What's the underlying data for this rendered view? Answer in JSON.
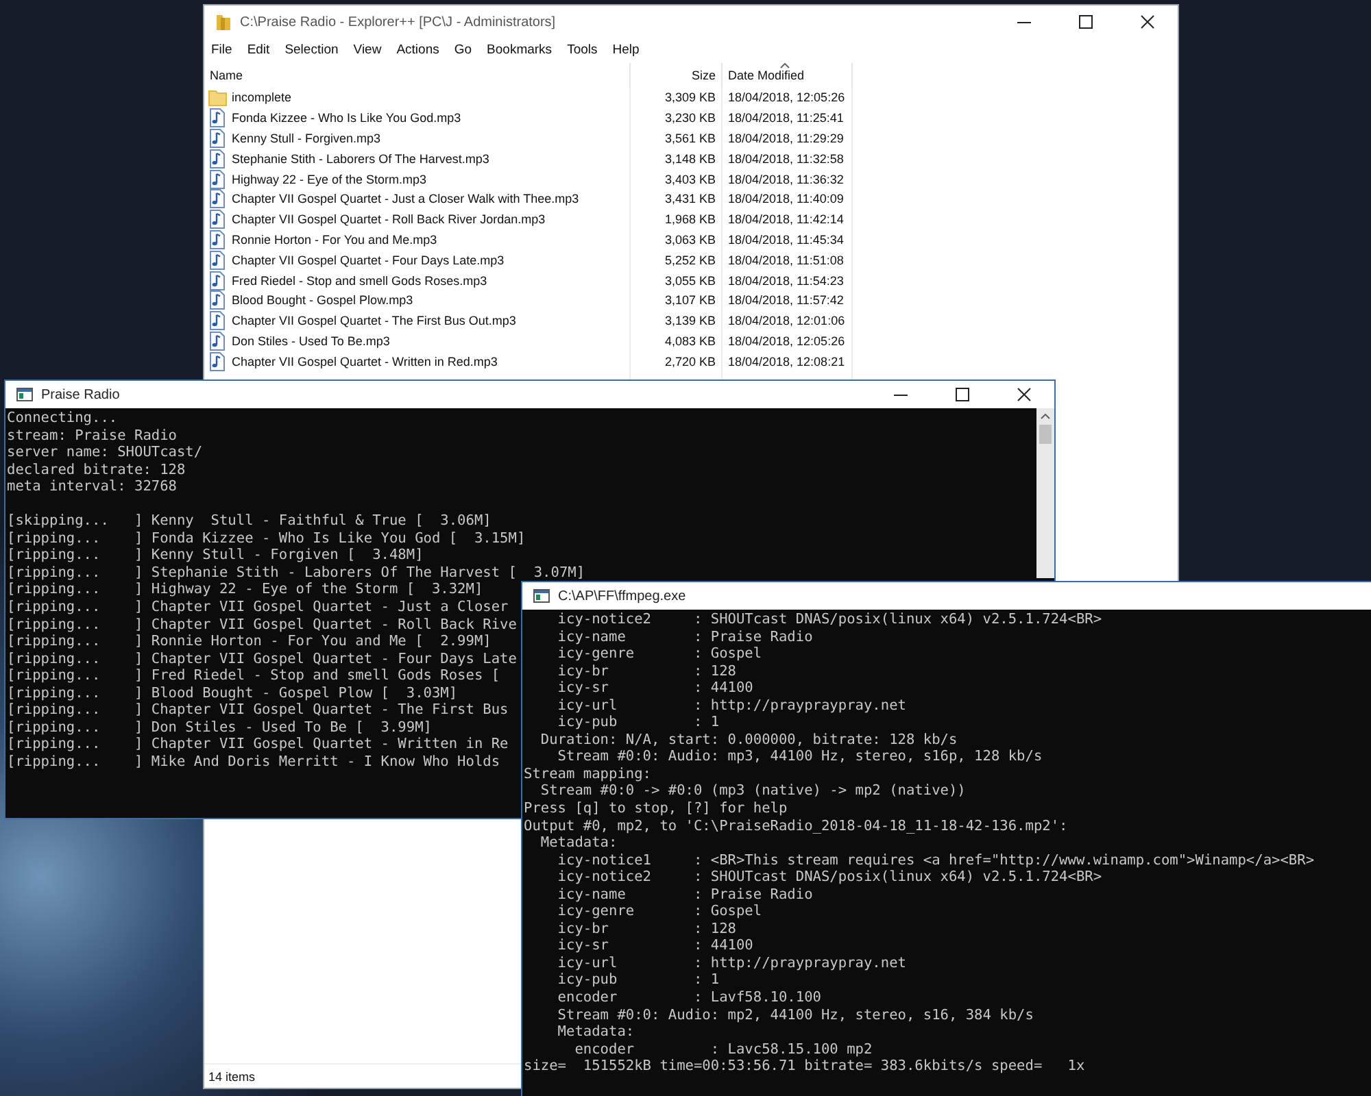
{
  "explorer": {
    "title": "C:\\Praise Radio - Explorer++ [PC\\J - Administrators]",
    "menu": [
      "File",
      "Edit",
      "Selection",
      "View",
      "Actions",
      "Go",
      "Bookmarks",
      "Tools",
      "Help"
    ],
    "columns": [
      {
        "label": "Name",
        "sorted": false
      },
      {
        "label": "Size",
        "sorted": false
      },
      {
        "label": "Date Modified",
        "sorted": true
      }
    ],
    "rows": [
      {
        "kind": "folder",
        "name": "incomplete",
        "size": "3,309 KB",
        "modified": "18/04/2018, 12:05:26"
      },
      {
        "kind": "audio",
        "name": "Fonda Kizzee - Who Is Like You God.mp3",
        "size": "3,230 KB",
        "modified": "18/04/2018, 11:25:41"
      },
      {
        "kind": "audio",
        "name": "Kenny Stull - Forgiven.mp3",
        "size": "3,561 KB",
        "modified": "18/04/2018, 11:29:29"
      },
      {
        "kind": "audio",
        "name": "Stephanie Stith - Laborers Of The Harvest.mp3",
        "size": "3,148 KB",
        "modified": "18/04/2018, 11:32:58"
      },
      {
        "kind": "audio",
        "name": "Highway 22 - Eye of the Storm.mp3",
        "size": "3,403 KB",
        "modified": "18/04/2018, 11:36:32"
      },
      {
        "kind": "audio",
        "name": "Chapter VII Gospel Quartet - Just a Closer Walk with Thee.mp3",
        "size": "3,431 KB",
        "modified": "18/04/2018, 11:40:09"
      },
      {
        "kind": "audio",
        "name": "Chapter VII Gospel Quartet - Roll Back River Jordan.mp3",
        "size": "1,968 KB",
        "modified": "18/04/2018, 11:42:14"
      },
      {
        "kind": "audio",
        "name": "Ronnie Horton - For You and Me.mp3",
        "size": "3,063 KB",
        "modified": "18/04/2018, 11:45:34"
      },
      {
        "kind": "audio",
        "name": "Chapter VII Gospel Quartet - Four Days Late.mp3",
        "size": "5,252 KB",
        "modified": "18/04/2018, 11:51:08"
      },
      {
        "kind": "audio",
        "name": "Fred Riedel - Stop and smell Gods Roses.mp3",
        "size": "3,055 KB",
        "modified": "18/04/2018, 11:54:23"
      },
      {
        "kind": "audio",
        "name": "Blood Bought - Gospel Plow.mp3",
        "size": "3,107 KB",
        "modified": "18/04/2018, 11:57:42"
      },
      {
        "kind": "audio",
        "name": "Chapter VII Gospel Quartet - The First Bus Out.mp3",
        "size": "3,139 KB",
        "modified": "18/04/2018, 12:01:06"
      },
      {
        "kind": "audio",
        "name": "Don Stiles - Used To Be.mp3",
        "size": "4,083 KB",
        "modified": "18/04/2018, 12:05:26"
      },
      {
        "kind": "audio",
        "name": "Chapter VII Gospel Quartet - Written in Red.mp3",
        "size": "2,720 KB",
        "modified": "18/04/2018, 12:08:21"
      }
    ],
    "status_bar": "14 items"
  },
  "streamripper": {
    "title": "Praise Radio",
    "header_lines": [
      "Connecting...",
      "stream: Praise Radio",
      "server name: SHOUTcast/",
      "declared bitrate: 128",
      "meta interval: 32768"
    ],
    "track_lines": [
      "[skipping...   ] Kenny  Stull - Faithful & True [  3.06M]",
      "[ripping...    ] Fonda Kizzee - Who Is Like You God [  3.15M]",
      "[ripping...    ] Kenny Stull - Forgiven [  3.48M]",
      "[ripping...    ] Stephanie Stith - Laborers Of The Harvest [  3.07M]",
      "[ripping...    ] Highway 22 - Eye of the Storm [  3.32M]",
      "[ripping...    ] Chapter VII Gospel Quartet - Just a Closer",
      "[ripping...    ] Chapter VII Gospel Quartet - Roll Back Rive",
      "[ripping...    ] Ronnie Horton - For You and Me [  2.99M]",
      "[ripping...    ] Chapter VII Gospel Quartet - Four Days Late",
      "[ripping...    ] Fred Riedel - Stop and smell Gods Roses [",
      "[ripping...    ] Blood Bought - Gospel Plow [  3.03M]",
      "[ripping...    ] Chapter VII Gospel Quartet - The First Bus",
      "[ripping...    ] Don Stiles - Used To Be [  3.99M]",
      "[ripping...    ] Chapter VII Gospel Quartet - Written in Re",
      "[ripping...    ] Mike And Doris Merritt - I Know Who Holds"
    ]
  },
  "ffmpeg": {
    "title": "C:\\AP\\FF\\ffmpeg.exe",
    "lines": [
      "    icy-notice2     : SHOUTcast DNAS/posix(linux x64) v2.5.1.724<BR>",
      "    icy-name        : Praise Radio",
      "    icy-genre       : Gospel",
      "    icy-br          : 128",
      "    icy-sr          : 44100",
      "    icy-url         : http://praypraypray.net",
      "    icy-pub         : 1",
      "  Duration: N/A, start: 0.000000, bitrate: 128 kb/s",
      "    Stream #0:0: Audio: mp3, 44100 Hz, stereo, s16p, 128 kb/s",
      "Stream mapping:",
      "  Stream #0:0 -> #0:0 (mp3 (native) -> mp2 (native))",
      "Press [q] to stop, [?] for help",
      "Output #0, mp2, to 'C:\\PraiseRadio_2018-04-18_11-18-42-136.mp2':",
      "  Metadata:",
      "    icy-notice1     : <BR>This stream requires <a href=\"http://www.winamp.com\">Winamp</a><BR>",
      "    icy-notice2     : SHOUTcast DNAS/posix(linux x64) v2.5.1.724<BR>",
      "    icy-name        : Praise Radio",
      "    icy-genre       : Gospel",
      "    icy-br          : 128",
      "    icy-sr          : 44100",
      "    icy-url         : http://praypraypray.net",
      "    icy-pub         : 1",
      "    encoder         : Lavf58.10.100",
      "    Stream #0:0: Audio: mp2, 44100 Hz, stereo, s16, 384 kb/s",
      "    Metadata:",
      "      encoder         : Lavc58.15.100 mp2",
      "size=  151552kB time=00:53:56.71 bitrate= 383.6kbits/s speed=   1x"
    ]
  }
}
